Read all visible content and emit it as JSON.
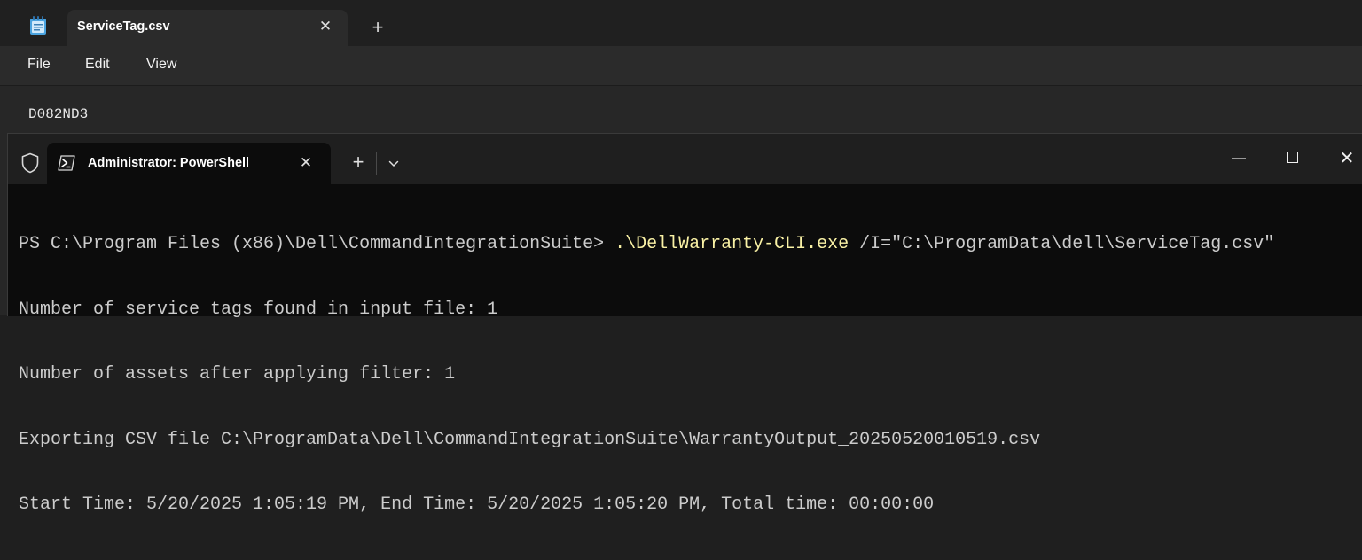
{
  "notepad": {
    "tab_title": "ServiceTag.csv",
    "tab_close": "✕",
    "new_tab": "+",
    "menu": [
      "File",
      "Edit",
      "View"
    ],
    "content_lines": [
      "D082ND3"
    ],
    "icon": "notepad-icon"
  },
  "terminal": {
    "tab_title": "Administrator: PowerShell",
    "tab_close": "✕",
    "new_tab": "+",
    "dropdown": "⌄",
    "controls": {
      "minimize": "—",
      "close": "✕"
    },
    "icons": [
      "shield-icon",
      "powershell-icon"
    ],
    "prompt": "PS C:\\Program Files (x86)\\Dell\\CommandIntegrationSuite> ",
    "command_exe": ".\\DellWarranty-CLI.exe",
    "command_args": " /I=\"C:\\ProgramData\\dell\\ServiceTag.csv\"",
    "output_lines": [
      "Number of service tags found in input file: 1",
      "Number of assets after applying filter: 1",
      "Exporting CSV file C:\\ProgramData\\Dell\\CommandIntegrationSuite\\WarrantyOutput_20250520010519.csv",
      "Start Time: 5/20/2025 1:05:19 PM, End Time: 5/20/2025 1:05:20 PM, Total time: 00:00:00"
    ]
  },
  "colors": {
    "terminal_bg": "#0c0c0c",
    "command_highlight": "#f9f1a5",
    "console_text": "#cccccc"
  }
}
